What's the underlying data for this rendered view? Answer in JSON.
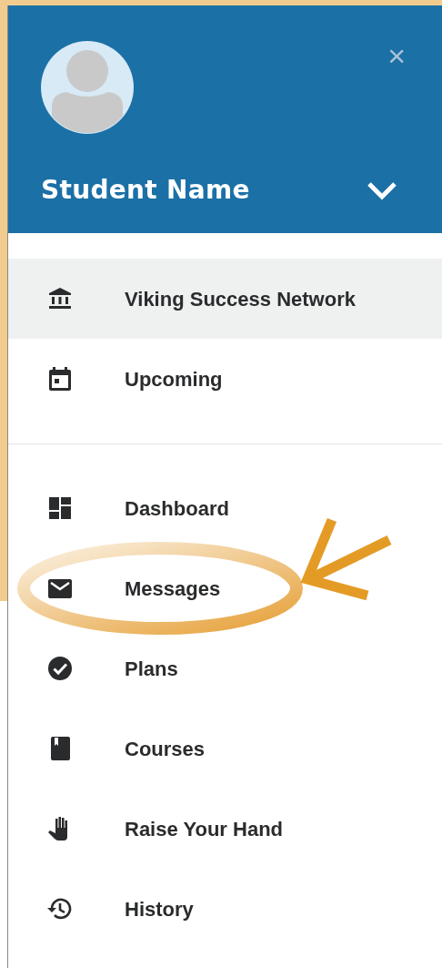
{
  "header": {
    "name": "Student Name",
    "close": "×"
  },
  "sections": [
    {
      "items": [
        {
          "label": "Viking Success Network",
          "selected": true
        },
        {
          "label": "Upcoming",
          "selected": false
        }
      ]
    },
    {
      "items": [
        {
          "label": "Dashboard",
          "selected": false
        },
        {
          "label": "Messages",
          "selected": false
        },
        {
          "label": "Plans",
          "selected": false
        },
        {
          "label": "Courses",
          "selected": false
        },
        {
          "label": "Raise Your Hand",
          "selected": false
        },
        {
          "label": "History",
          "selected": false
        }
      ]
    }
  ]
}
